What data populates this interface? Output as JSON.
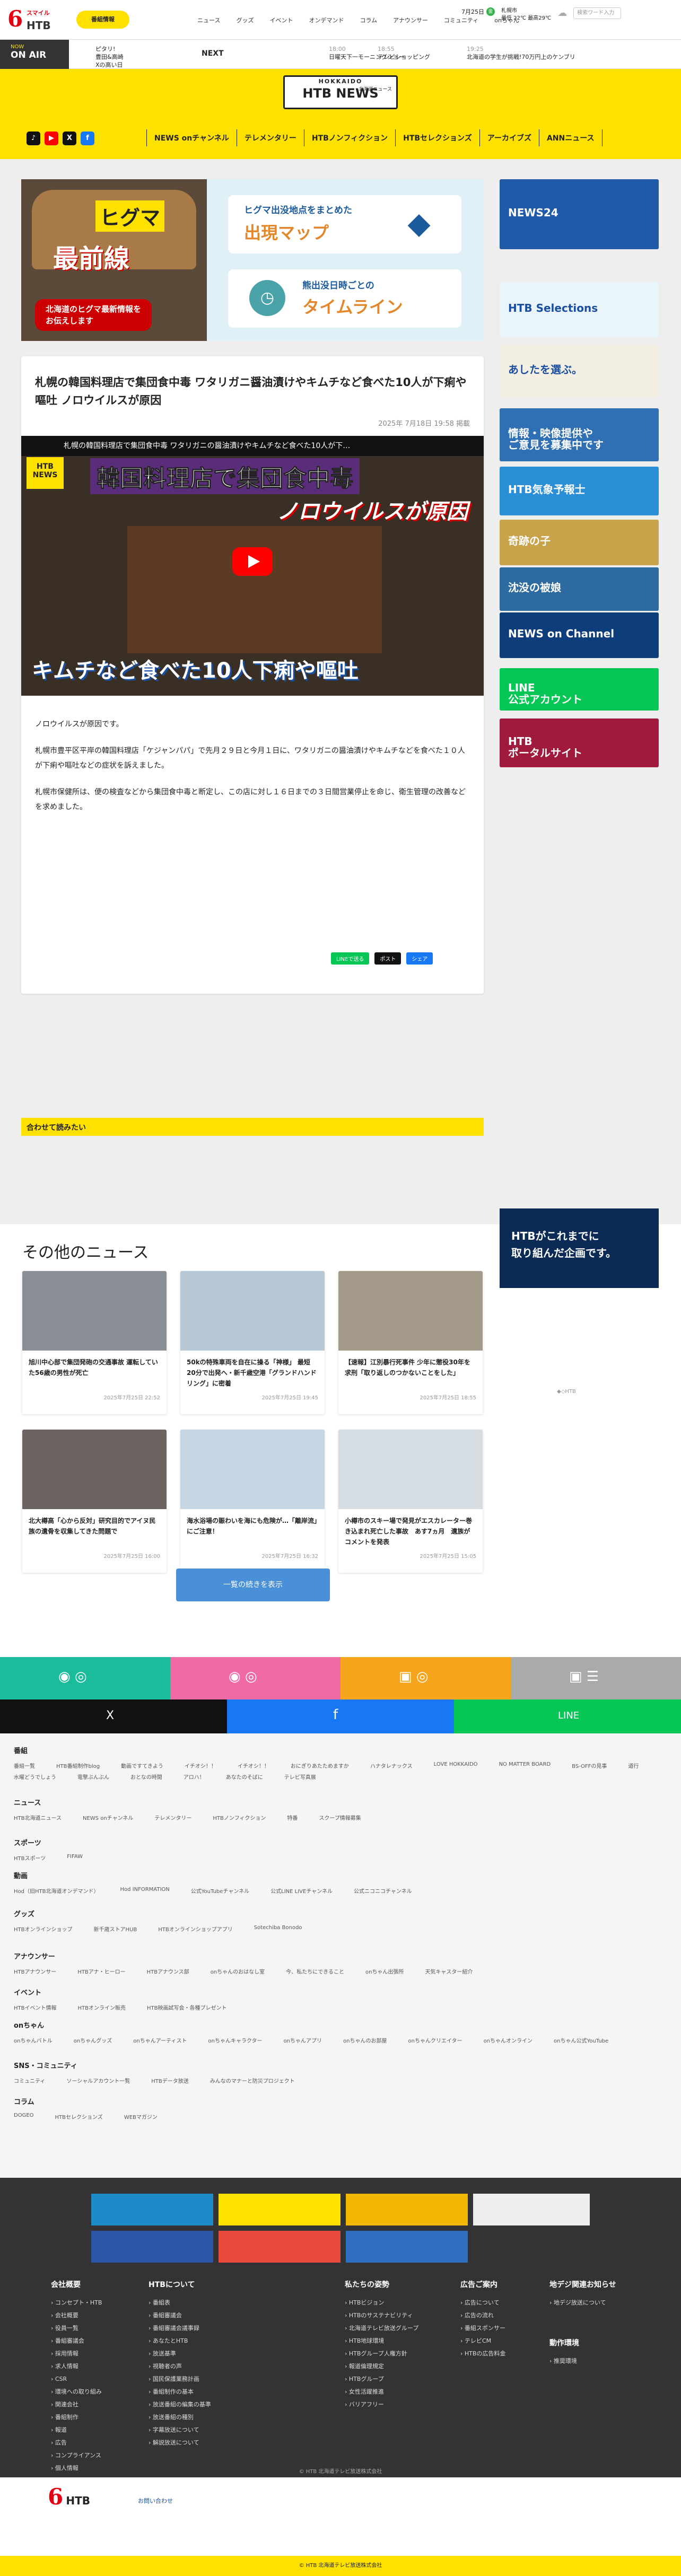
{
  "header": {
    "logo_small": "スマイル",
    "logo_htb": "HTB",
    "broadcast": "番組情報",
    "nav": [
      "ニュース",
      "グッズ",
      "イベント",
      "オンデマンド",
      "コラム",
      "アナウンサー",
      "コミュニティ",
      "onちゃん"
    ],
    "date": "7月25日",
    "weather": "札幌市\n最低 22℃ 最高29℃",
    "search_placeholder": "検索ワード入力",
    "search_label": "検索"
  },
  "onair": {
    "now_label": "NOW",
    "onair_label": "ON AIR",
    "now_program": "ピタリ!\n豊田&高崎\nXの高い日",
    "next_label": "NEXT",
    "next_programs": [
      {
        "time": "18:00",
        "title": "日曜天下一モーニングショー"
      },
      {
        "time": "18:55",
        "title": "テレビショッピング"
      },
      {
        "time": "19:25",
        "title": "北海道の学生が挑戦!70万円上のケンブリ"
      }
    ]
  },
  "newsbar": {
    "hokkaido": "HOKKAIDO",
    "htbnews": "HTB NEWS",
    "htbnews_sub": "北海道ニュース",
    "sns": [
      "TikTok",
      "YouTube",
      "X",
      "Facebook"
    ],
    "categories": [
      "NEWS onチャンネル",
      "テレメンタリー",
      "HTBノンフィクション",
      "HTBセレクションズ",
      "アーカイブズ",
      "ANNニュース"
    ]
  },
  "hero": {
    "title_a": "ヒグマ",
    "title_b": "最前線",
    "subtitle": "北海道のヒグマ最新情報を\nお伝えします",
    "map_a": "ヒグマ出没地点をまとめた",
    "map_b": "出現マップ",
    "tl_a": "熊出没日時ごとの",
    "tl_b": "タイムライン"
  },
  "article": {
    "title": "札幌の韓国料理店で集団食中毒 ワタリガニ醤油漬けやキムチなど食べた10人が下痢や嘔吐 ノロウイルスが原因",
    "date": "2025年 7月18日 19:58 掲載",
    "video_head": "札幌の韓国料理店で集団食中毒 ワタリガニの醤油漬けやキムチなど食べた10人が下…",
    "video_tag": "HTB\nNEWS",
    "video_cap1": "韓国料理店で集団食中毒",
    "video_cap2": "ノロウイルスが原因",
    "video_cap3": "キムチなど食べた10人下痢や嘔吐",
    "paragraphs": [
      "ノロウイルスが原因です。",
      "札幌市豊平区平岸の韓国料理店「ケジャンパパ」で先月２９日と今月１日に、ワタリガニの醤油漬けやキムチなどを食べた１０人が下痢や嘔吐などの症状を訴えました。",
      "札幌市保健所は、便の検査などから集団食中毒と断定し、この店に対し１６日までの３日間営業停止を命じ、衛生管理の改善などを求めました。"
    ],
    "share": [
      "LINEで送る",
      "ポスト",
      "シェア"
    ],
    "read_together": "合わせて読みたい"
  },
  "sidebar": [
    {
      "label": "NEWS24",
      "bg": "#1e5aa8"
    },
    {
      "label": "HTB Selections",
      "bg": "#eaf4fb"
    },
    {
      "label": "あしたを選ぶ。",
      "bg": "#f3efe3"
    },
    {
      "label": "情報・映像提供や\nご意見を募集中です",
      "bg": "#2f6fb4"
    },
    {
      "label": "HTB気象予報士",
      "bg": "#2a8fd6"
    },
    {
      "label": "奇跡の子",
      "bg": "#c9a34a"
    },
    {
      "label": "沈没の被娘",
      "bg": "#2d6aa0"
    },
    {
      "label": "NEWS on Channel",
      "bg": "#0d3d7a"
    },
    {
      "label": "LINE\n公式アカウント",
      "bg": "#06c755"
    },
    {
      "label": "HTB\nポータルサイト",
      "bg": "#a01a3e"
    }
  ],
  "other": {
    "title": "その他のニュース",
    "cards": [
      {
        "title": "旭川中心部で集団発砲の交通事故 運転していた56歳の男性が死亡",
        "date": "2025年7月25日 22:52"
      },
      {
        "title": "50kの特殊車両を自在に操る「神様」 最短20分で出発へ・新千歳空港「グランドハンドリング」に密着",
        "date": "2025年7月25日 19:45"
      },
      {
        "title": "【速報】江別暴行死事件 少年に懲役30年を求刑「取り返しのつかないことをした」",
        "date": "2025年7月25日 18:55"
      },
      {
        "title": "北大樽高「心から反対」研究目的でアイヌ民族の遺骨を収集してきた問題で",
        "date": "2025年7月25日 16:00"
      },
      {
        "title": "海水浴場の賑わいを海にも危険が…「離岸流」にご注意！",
        "date": "2025年7月25日 16:32"
      },
      {
        "title": "小樽市のスキー場で発見がエスカレーター巻き込まれ死亡した事故　あす7ヵ月　遺族がコメントを発表",
        "date": "2025年7月25日 15:05"
      }
    ],
    "more": "一覧の続きを表示",
    "ad_text": "HTBがこれまでに\n取り組んだ企画です。",
    "ad_caption": "◆◇HTB"
  },
  "colors": {
    "yellow": "#ffe100",
    "red": "#e60012",
    "green": "#06c755",
    "pink": "#f06aa5",
    "teal": "#1abc9c",
    "orange": "#f7a51c"
  },
  "footer_sections": [
    {
      "h": "番組",
      "items": [
        "番組一覧",
        "HTB番組制作blog",
        "動画ですてきよう",
        "イチオシ！！",
        "イチオシ！！",
        "おにぎりあたためますか",
        "ハナタレナックス",
        "LOVE HOKKAIDO",
        "NO MATTER BOARD",
        "BS-OFFの見事",
        "道行",
        "水曜どうでしょう",
        "電撃ぶんぶん",
        "おとなの時間",
        "アロハ！",
        "あなたのそばに",
        "テレビ写真展"
      ]
    },
    {
      "h": "ニュース",
      "items": [
        "HTB北海道ニュース",
        "NEWS onチャンネル",
        "テレメンタリー",
        "HTBノンフィクション",
        "特番",
        "スクープ情報募集"
      ]
    },
    {
      "h": "スポーツ",
      "items": [
        "HTBスポーツ",
        "FIFAW"
      ]
    },
    {
      "h": "動画",
      "items": [
        "Hod（旧HTB北海道オンデマンド）",
        "Hod INFORMATION",
        "公式YouTubeチャンネル",
        "公式LINE LIVEチャンネル",
        "公式ニコニコチャンネル"
      ]
    },
    {
      "h": "グッズ",
      "items": [
        "HTBオンラインショップ",
        "新千歳ストアHUB",
        "HTBオンラインショップアプリ",
        "Sotechiba Bonodo"
      ]
    },
    {
      "h": "アナウンサー",
      "items": [
        "HTBアナウンサー",
        "HTBアナ・ヒーロー",
        "HTBアナウンス部",
        "onちゃんのおはなし室",
        "今、私たちにできること",
        "onちゃん出張所",
        "天気キャスター紹介"
      ]
    },
    {
      "h": "イベント",
      "items": [
        "HTBイベント情報",
        "HTBオンライン販売",
        "HTB映画試写会・各種プレゼント"
      ]
    },
    {
      "h": "onちゃん",
      "items": [
        "onちゃんバトル",
        "onちゃんグッズ",
        "onちゃんアーティスト",
        "onちゃんキャラクター",
        "onちゃんアプリ",
        "onちゃんのお部屋",
        "onちゃんクリエイター",
        "onちゃんオンライン",
        "onちゃん公式YouTube"
      ]
    },
    {
      "h": "SNS・コミュニティ",
      "items": [
        "コミュニティ",
        "ソーシャルアカウント一覧",
        "HTBデータ放送",
        "みんなのマナーと防災プロジェクト"
      ]
    },
    {
      "h": "コラム",
      "items": [
        "DOGEO",
        "HTBセレクションズ",
        "WEBマガジン"
      ]
    }
  ],
  "dark_cols": [
    {
      "h": "会社概要",
      "items": [
        "コンセプト・HTB",
        "会社概要",
        "役員一覧",
        "番組審議会",
        "採用情報",
        "求人情報",
        "CSR",
        "環境への取り組み",
        "関連会社",
        "番組制作",
        "報道",
        "広告",
        "コンプライアンス",
        "個人情報",
        "お問い合わせ"
      ]
    },
    {
      "h": "HTBについて",
      "items": [
        "番組表",
        "番組審議会",
        "番組審議会議事録",
        "あなたとHTB",
        "放送基準",
        "視聴者の声",
        "国民保護業務計画",
        "番組制作の基本",
        "放送番組の編集の基準",
        "放送番組の種別",
        "字幕放送について",
        "解説放送について"
      ]
    },
    {
      "h": "私たちの姿勢",
      "items": [
        "HTBビジョン",
        "HTBのサステナビリティ",
        "北海道テレビ放送グループ",
        "HTB地球環境",
        "HTBグループ人権方針",
        "報道倫理規定",
        "HTBグループ",
        "女性活躍推進",
        "バリアフリー"
      ]
    },
    {
      "h": "広告ご案内",
      "items": [
        "広告について",
        "広告の流れ",
        "番組スポンサー",
        "テレビCM",
        "HTBの広告料金"
      ]
    },
    {
      "h": "地デジ関連お知らせ",
      "items": [
        "地デジ放送について"
      ]
    },
    {
      "h": "動作環境",
      "items": [
        "推奨環境"
      ]
    }
  ],
  "copyright": "© HTB 北海道テレビ放送株式会社",
  "footer_bottom": "お問い合わせ"
}
